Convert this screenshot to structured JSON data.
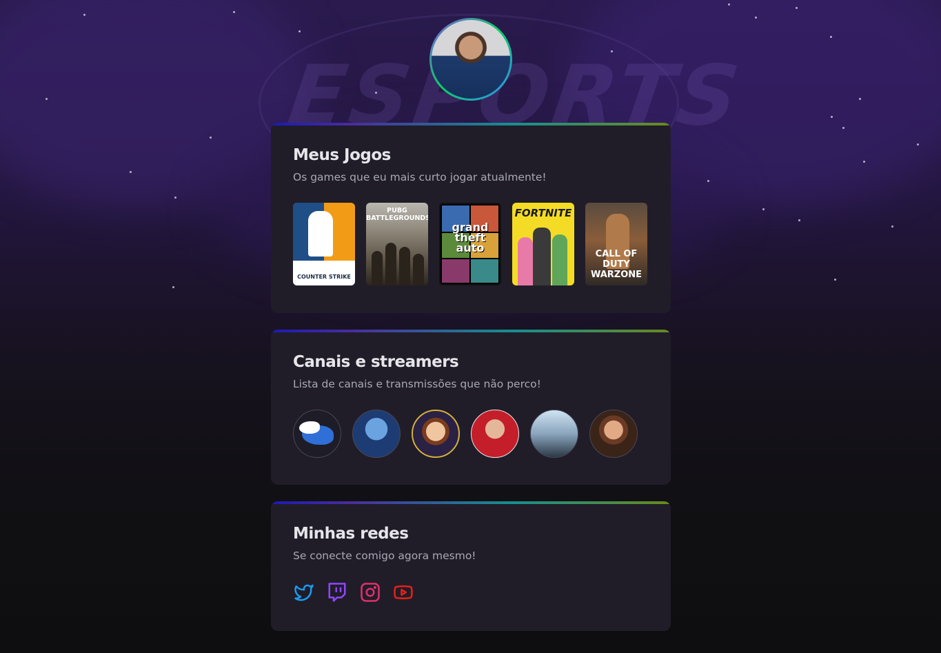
{
  "profile": {
    "avatar_alt": "Foto de perfil"
  },
  "games_card": {
    "title": "Meus Jogos",
    "subtitle": "Os games que eu mais curto jogar atualmente!",
    "games": [
      {
        "name": "COUNTER STRIKE"
      },
      {
        "name": "PUBG BATTLEGROUNDS"
      },
      {
        "name": "grand theft auto"
      },
      {
        "name": "FORTNITE"
      },
      {
        "name": "CALL OF DUTY WARZONE"
      }
    ]
  },
  "channels_card": {
    "title": "Canais e streamers",
    "subtitle": "Lista de canais e transmissões que não perco!",
    "channels": [
      {},
      {},
      {},
      {},
      {},
      {}
    ]
  },
  "social_card": {
    "title": "Minhas redes",
    "subtitle": "Se conecte comigo agora mesmo!",
    "links": [
      {
        "icon": "twitter-icon",
        "color": "#1d9bf0"
      },
      {
        "icon": "twitch-icon",
        "color": "#9147ff"
      },
      {
        "icon": "instagram-icon",
        "color": "#e1306c"
      },
      {
        "icon": "youtube-icon",
        "color": "#e62117"
      }
    ]
  },
  "colors": {
    "card_bg": "#201d29",
    "text_primary": "#e6e6ea",
    "text_secondary": "#a8a8b3"
  }
}
